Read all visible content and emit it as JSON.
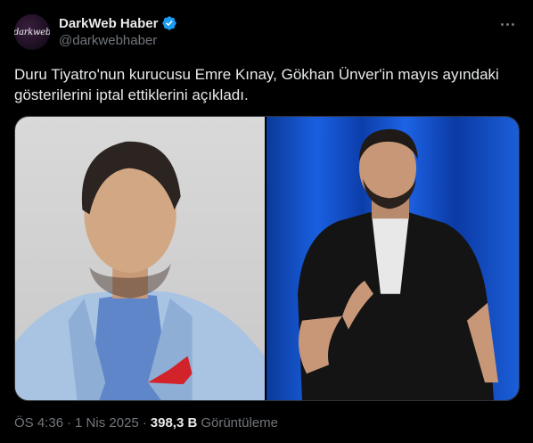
{
  "author": {
    "display_name": "DarkWeb Haber",
    "handle": "@darkwebhaber",
    "avatar_text": "darkweb",
    "verified": true,
    "verified_color": "#1d9bf0"
  },
  "tweet": {
    "text": "Duru Tiyatro'nun kurucusu Emre Kınay, Gökhan Ünver'in mayıs ayındaki gösterilerini iptal ettiklerini açıkladı."
  },
  "media": {
    "count": 2
  },
  "meta": {
    "time": "ÖS 4:36",
    "date": "1 Nis 2025",
    "separator": "·",
    "views_count": "398,3 B",
    "views_label": "Görüntüleme"
  },
  "colors": {
    "background": "#000000",
    "text_primary": "#e7e9ea",
    "text_secondary": "#71767b"
  }
}
